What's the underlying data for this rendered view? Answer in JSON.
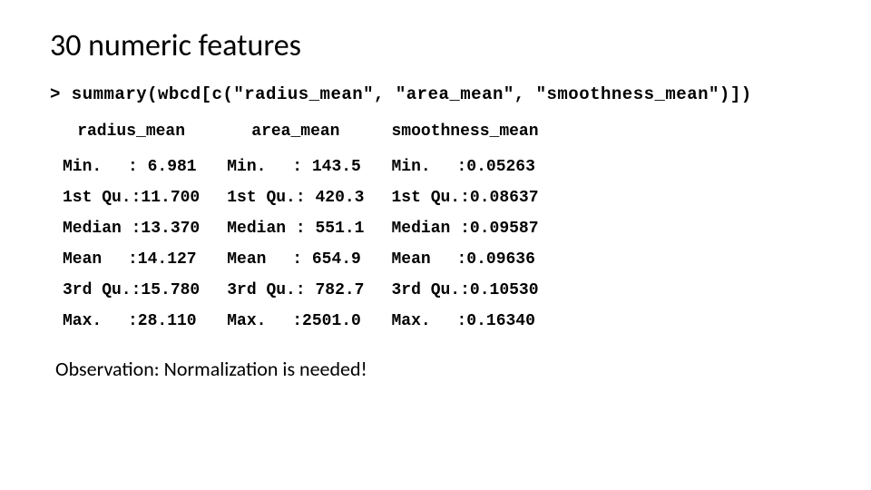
{
  "title": "30 numeric features",
  "code_line": "> summary(wbcd[c(\"radius_mean\", \"area_mean\", \"smoothness_mean\")])",
  "headers": [
    "radius_mean",
    "area_mean",
    "smoothness_mean"
  ],
  "rows": [
    {
      "label": "Min.",
      "values": [
        ": 6.981",
        ": 143.5",
        ":0.05263"
      ]
    },
    {
      "label": "1st Qu.",
      "values": [
        ":11.700",
        ": 420.3",
        ":0.08637"
      ]
    },
    {
      "label": "Median ",
      "values": [
        ":13.370",
        ": 551.1",
        ":0.09587"
      ]
    },
    {
      "label": "Mean",
      "values": [
        ":14.127",
        ": 654.9",
        ":0.09636"
      ]
    },
    {
      "label": "3rd Qu.",
      "values": [
        ":15.780",
        ": 782.7",
        ":0.10530"
      ]
    },
    {
      "label": "Max.",
      "values": [
        ":28.110",
        ":2501.0",
        ":0.16340"
      ]
    }
  ],
  "observation": "Observation: Normalization is needed!",
  "chart_data": {
    "type": "table",
    "title": "R summary() output for selected WBCD features",
    "columns": [
      "radius_mean",
      "area_mean",
      "smoothness_mean"
    ],
    "statistics": [
      "Min.",
      "1st Qu.",
      "Median",
      "Mean",
      "3rd Qu.",
      "Max."
    ],
    "data": {
      "radius_mean": [
        6.981,
        11.7,
        13.37,
        14.127,
        15.78,
        28.11
      ],
      "area_mean": [
        143.5,
        420.3,
        551.1,
        654.9,
        782.7,
        2501.0
      ],
      "smoothness_mean": [
        0.05263,
        0.08637,
        0.09587,
        0.09636,
        0.1053,
        0.1634
      ]
    }
  }
}
